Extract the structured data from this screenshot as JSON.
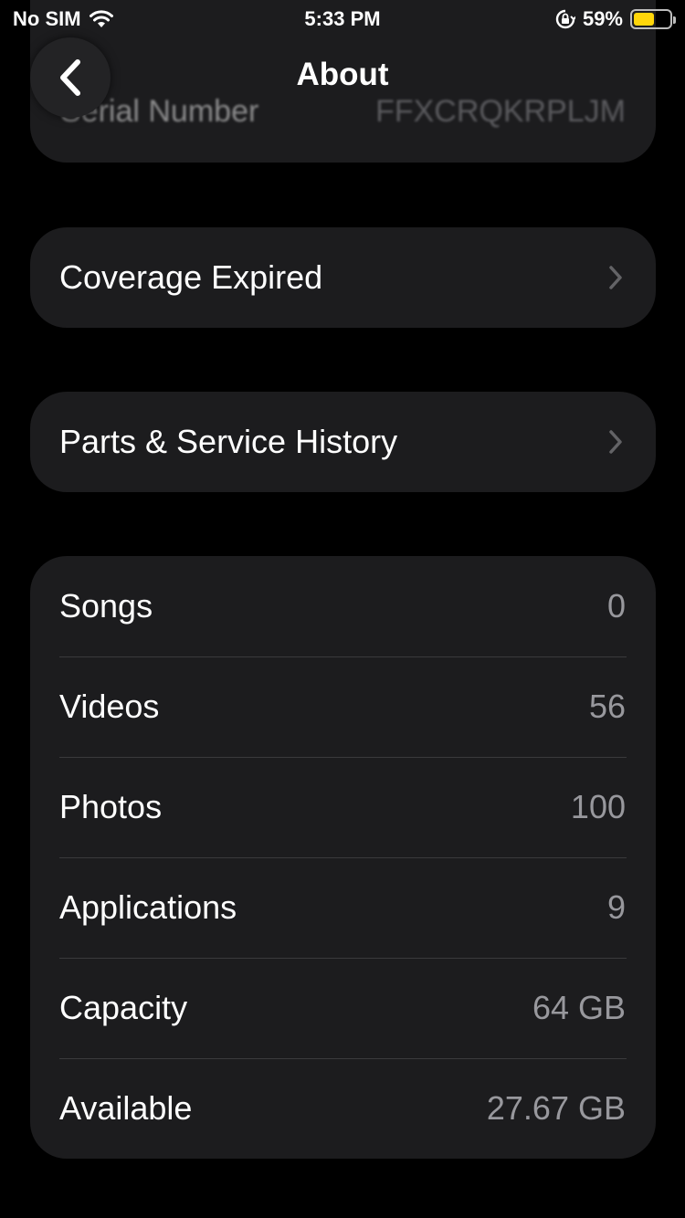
{
  "status_bar": {
    "carrier": "No SIM",
    "time": "5:33 PM",
    "battery_percent": "59%",
    "battery_level": 0.59,
    "battery_color": "#ffd60a"
  },
  "nav": {
    "title": "About",
    "back_icon": "chevron-left-icon"
  },
  "header_row": {
    "label": "Serial Number",
    "value": "FFXCRQKRPLJM"
  },
  "links": [
    {
      "label": "Coverage Expired"
    },
    {
      "label": "Parts & Service History"
    }
  ],
  "stats": [
    {
      "label": "Songs",
      "value": "0"
    },
    {
      "label": "Videos",
      "value": "56"
    },
    {
      "label": "Photos",
      "value": "100"
    },
    {
      "label": "Applications",
      "value": "9"
    },
    {
      "label": "Capacity",
      "value": "64 GB"
    },
    {
      "label": "Available",
      "value": "27.67 GB"
    }
  ]
}
